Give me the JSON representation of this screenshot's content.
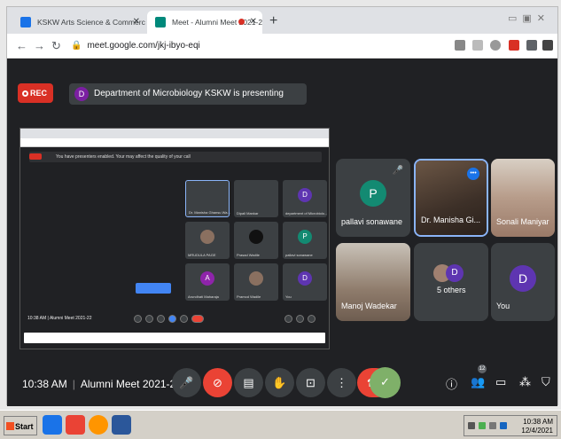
{
  "browser": {
    "tabs": [
      {
        "title": "KSKW Arts Science & Commerce",
        "icon": "college-favicon"
      },
      {
        "title": "Meet - Alumni Meet 2021-22",
        "icon": "meet-favicon"
      }
    ],
    "url": "meet.google.com/jkj-ibyo-eqi"
  },
  "meet": {
    "rec_label": "REC",
    "presenting_avatar": "D",
    "presenting_text": "Department of Microbiology KSKW is presenting",
    "participants": [
      {
        "name": "pallavi sonawane",
        "initial": "P",
        "color": "#138a72"
      },
      {
        "name": "Dr. Manisha Gi...",
        "initial": "",
        "color": "#5a4a3a"
      },
      {
        "name": "Sonali Maniyar",
        "initial": "",
        "color": "#a58a7a"
      },
      {
        "name": "Manoj Wadekar",
        "initial": "",
        "color": "#8a7a6a"
      },
      {
        "name": "5 others",
        "initial": "D",
        "color": "#5e35b1"
      },
      {
        "name": "You",
        "initial": "D",
        "color": "#5e35b1"
      }
    ],
    "time": "10:38 AM",
    "meeting_name": "Alumni Meet 2021-22",
    "people_count": "12"
  },
  "shared_screen": {
    "note": "You have presenters enabled. Your may affect the quality of your call",
    "time": "10:38 AM",
    "meeting_name": "Alumni Meet 2021-22",
    "tiles": [
      {
        "name": "Dr. Manisha Ghansu Wa...",
        "initial": "",
        "color": "#3c4043"
      },
      {
        "name": "Dipali Mankar",
        "initial": "",
        "color": "#3c4043"
      },
      {
        "name": "department of Microbiolo...",
        "initial": "D",
        "color": "#5e35b1"
      },
      {
        "name": "MRUDULA PAGE",
        "initial": "",
        "color": "#3c4043"
      },
      {
        "name": "Prasad Wadile",
        "initial": "",
        "color": "#3c4043"
      },
      {
        "name": "pallavi sonawane",
        "initial": "P",
        "color": "#138a72"
      },
      {
        "name": "Arundhati Maharaja",
        "initial": "A",
        "color": "#8e24aa"
      },
      {
        "name": "Pramod Wadile",
        "initial": "",
        "color": "#3c4043"
      },
      {
        "name": "You",
        "initial": "D",
        "color": "#5e35b1"
      }
    ]
  },
  "taskbar": {
    "start_label": "Start",
    "time": "10:38 AM",
    "date": "12/4/2021"
  }
}
